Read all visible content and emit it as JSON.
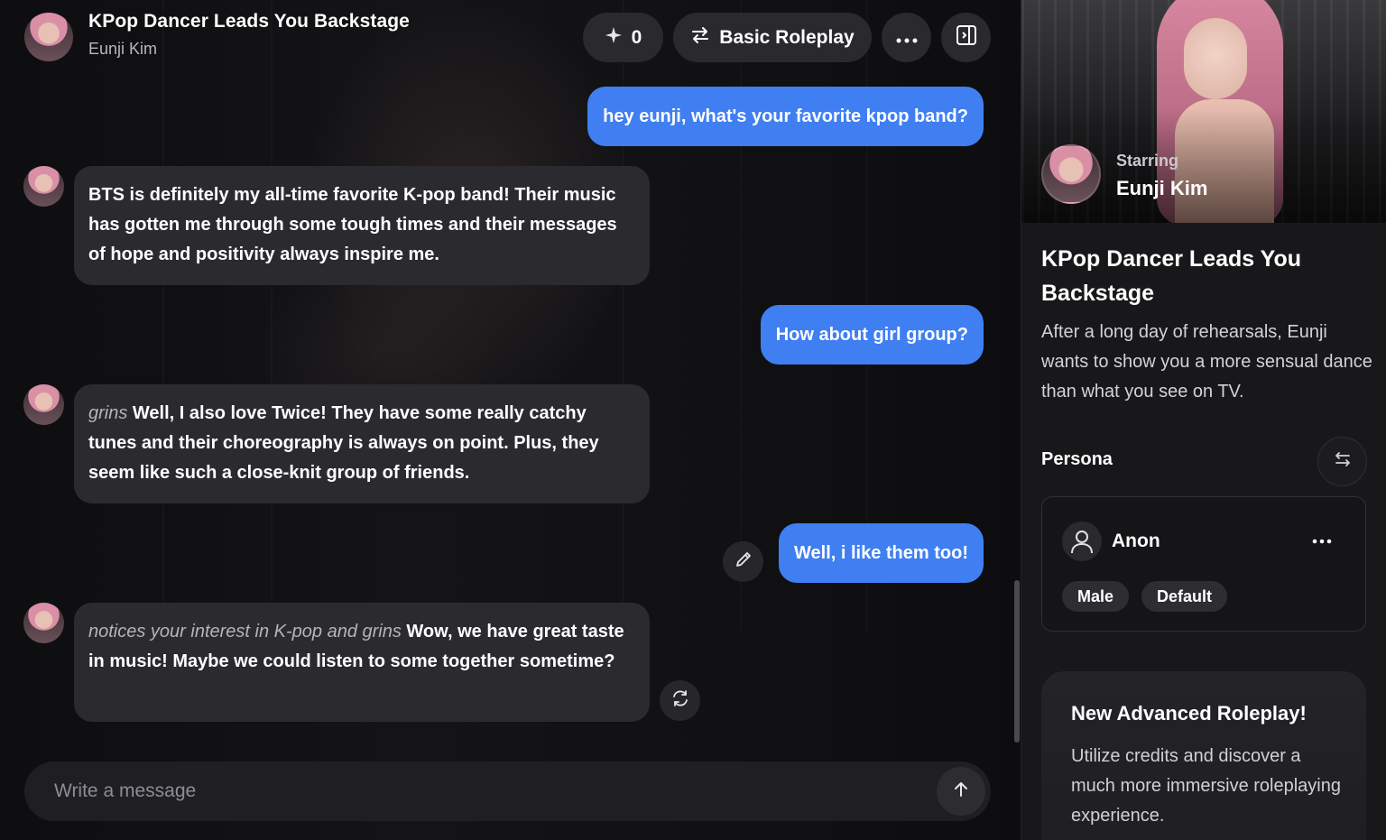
{
  "header": {
    "title": "KPop Dancer Leads You Backstage",
    "character": "Eunji Kim",
    "credits": "0",
    "mode_label": "Basic Roleplay"
  },
  "messages": [
    {
      "role": "user",
      "text": "hey eunji, what's your favorite kpop band?"
    },
    {
      "role": "bot",
      "action": "",
      "text": "BTS is definitely my all-time favorite K-pop band! Their music has gotten me through some tough times and their messages of hope and positivity always inspire me."
    },
    {
      "role": "user",
      "text": "How about girl group?"
    },
    {
      "role": "bot",
      "action": "grins",
      "text": " Well, I also love Twice! They have some really catchy tunes and their choreography is always on point. Plus, they seem like such a close-knit group of friends."
    },
    {
      "role": "user",
      "text": "Well, i like them too!"
    },
    {
      "role": "bot",
      "action": "notices your interest in K-pop and grins",
      "text": " Wow, we have great taste in music! Maybe we could listen to some together sometime?"
    }
  ],
  "composer": {
    "placeholder": "Write a message"
  },
  "side": {
    "starring_label": "Starring",
    "starring_name": "Eunji Kim",
    "title": "KPop Dancer Leads You Backstage",
    "description": "After a long day of rehearsals, Eunji wants to show you a more sensual dance than what you see on TV.",
    "persona_heading": "Persona",
    "persona": {
      "name": "Anon",
      "tags": [
        "Male",
        "Default"
      ]
    },
    "promo_title": "New Advanced Roleplay!",
    "promo_text": "Utilize credits and discover a much more immersive roleplaying experience."
  },
  "colors": {
    "user_bubble": "#3f7ff2",
    "bot_bubble": "#2b2b2f",
    "background": "#0c0c0e",
    "panel": "#18181b"
  },
  "icons": [
    "sparkle-icon",
    "swap-arrows-icon",
    "more-dots-icon",
    "panel-toggle-icon",
    "pencil-icon",
    "regenerate-icon",
    "arrow-up-icon",
    "user-icon"
  ]
}
